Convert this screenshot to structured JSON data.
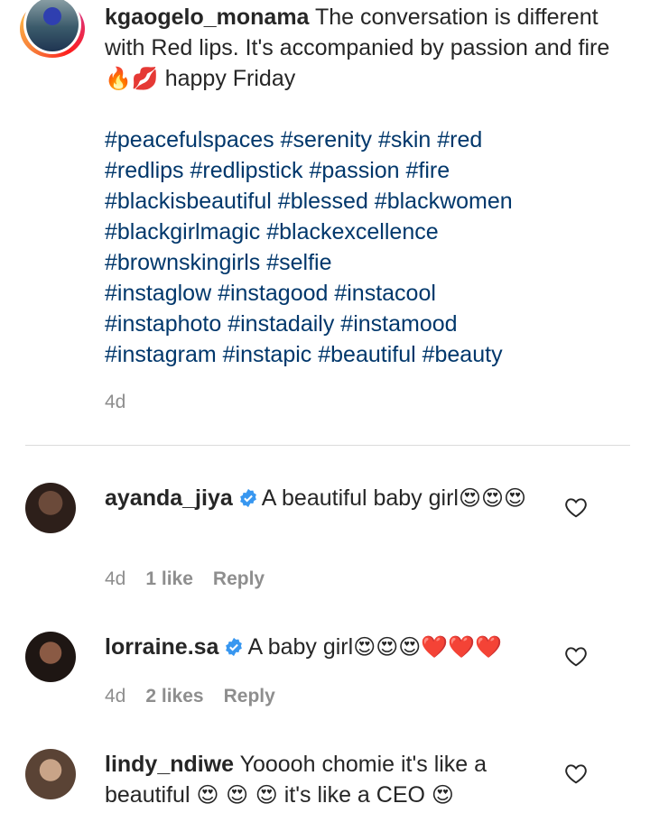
{
  "post": {
    "username": "kgaogelo_monama",
    "caption_text": "The conversation is different with Red lips. It's accompanied by passion and fire",
    "caption_emojis": "🔥💋",
    "caption_tail": " happy Friday",
    "hashtag_lines": [
      "#peacefulspaces #serenity #skin #red",
      "#redlips #redlipstick #passion #fire",
      "#blackisbeautiful #blessed #blackwomen",
      "#blackgirlmagic #blackexcellence",
      "#brownskingirls #selfie",
      "#instaglow #instagood #instacool",
      "#instaphoto #instadaily #instamood",
      "#instagram #instapic #beautiful #beauty"
    ],
    "time": "4d"
  },
  "comments": [
    {
      "username": "ayanda_jiya",
      "verified": true,
      "text": "A beautiful baby girl",
      "emojis": "😍😍😍",
      "time": "4d",
      "likes": "1 like",
      "reply": "Reply"
    },
    {
      "username": "lorraine.sa",
      "verified": true,
      "text": "A baby girl",
      "emojis": "😍😍😍❤️❤️❤️",
      "time": "4d",
      "likes": "2 likes",
      "reply": "Reply"
    },
    {
      "username": "lindy_ndiwe",
      "verified": false,
      "text": "Yooooh chomie it's like a beautiful ",
      "emojis": "😍 😍 😍",
      "text2": " it's like a CEO ",
      "emojis2": "😍"
    }
  ],
  "colors": {
    "text": "#262626",
    "hashtag": "#00376b",
    "muted": "#8e8e8e",
    "verified": "#3897f0",
    "divider": "#dbdbdb"
  },
  "icons": {
    "like": "heart-outline-icon",
    "verified": "verified-badge-icon"
  }
}
